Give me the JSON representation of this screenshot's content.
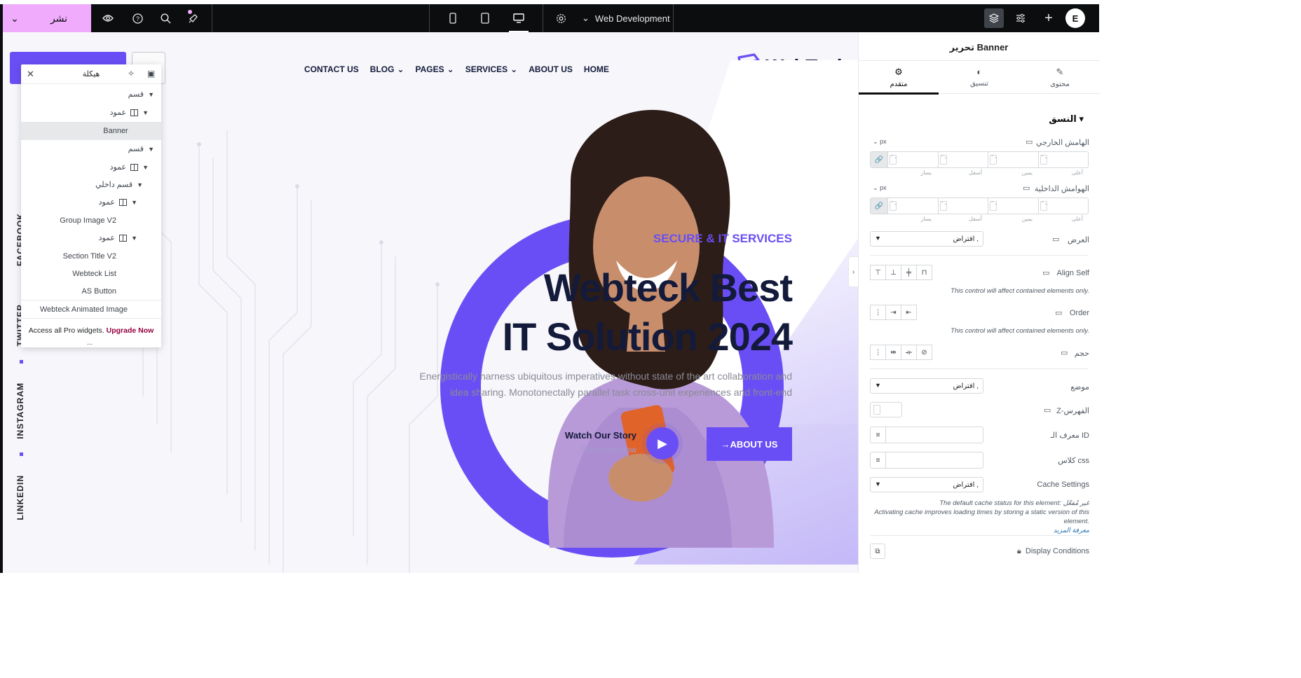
{
  "topbar": {
    "publish_label": "نشر",
    "site_name": "Web Development",
    "icons": [
      "chevron-down-icon",
      "eye-icon",
      "help-icon",
      "search-icon",
      "notifications-icon",
      "mobile-icon",
      "tablet-icon",
      "desktop-icon",
      "settings-icon",
      "layers-icon",
      "sliders-icon",
      "plus-icon",
      "elementor-logo-icon"
    ],
    "logo_letter": "E"
  },
  "canvas": {
    "nav": [
      "CONTACT US",
      "BLOG",
      "PAGES",
      "SERVICES",
      "ABOUT US",
      "HOME"
    ],
    "logo_text": "WebTeck",
    "eyebrow": "SECURE & IT SERVICES",
    "headline_line1": "Webteck Best",
    "headline_line2": "IT Solution 2024",
    "paragraph": "Energistically harness ubiquitous imperatives without state of the art collaboration and idea sharing. Monotonectally parallel task cross-unit experiences and front-end",
    "watch_title": "Watch Our Story",
    "watch_sub": "Subscribe Now",
    "about_button": "→ABOUT US",
    "social": [
      "FACEBOOK",
      "TWITTER",
      "INSTAGRAM",
      "LINKEDIN"
    ],
    "accent": "#6a4ef5"
  },
  "navigator": {
    "title": "هيكلة",
    "rows": [
      {
        "label": "قسم"
      },
      {
        "label": "عمود"
      },
      {
        "label": "Banner"
      },
      {
        "label": "قسم"
      },
      {
        "label": "عمود"
      },
      {
        "label": "قسم داخلي"
      },
      {
        "label": "عمود"
      },
      {
        "label": "Group Image V2"
      },
      {
        "label": "عمود"
      },
      {
        "label": "Section Title V2"
      },
      {
        "label": "Webteck List"
      },
      {
        "label": "AS Button"
      },
      {
        "label": "Webteck Animated Image"
      }
    ],
    "pro_text": "Access all Pro widgets.",
    "pro_link": "Upgrade Now",
    "more": "..."
  },
  "panel": {
    "title": "تحرير Banner",
    "tabs": [
      "متقدم",
      "تنسيق",
      "محتوى"
    ],
    "section": "النسق",
    "margin_label": "الهامش الخارجي",
    "padding_label": "الهوامش الداخلية",
    "unit": "px",
    "dim_labels": [
      "يسار",
      "أسفل",
      "يمين",
      "أعلى"
    ],
    "width_label": "العرض",
    "width_value": "افتراض ,",
    "align_self_label": "Align Self",
    "contained_note": "This control will affect contained elements only.",
    "order_label": "Order",
    "size_label": "حجم",
    "position_label": "موضع",
    "position_value": "افتراض ,",
    "z_label": "Z-الفهرس",
    "id_label": "معرف الـ ID",
    "css_label": "كلاس css",
    "cache_label": "Cache Settings",
    "cache_value": "افتراض ,",
    "cache_note_1": "The default cache status for this element: غير مُفعّل",
    "cache_note_2": "Activating cache improves loading times by storing a static version of this element.",
    "cache_note_link": "معرفة المزيد",
    "display_conditions": "Display Conditions"
  }
}
